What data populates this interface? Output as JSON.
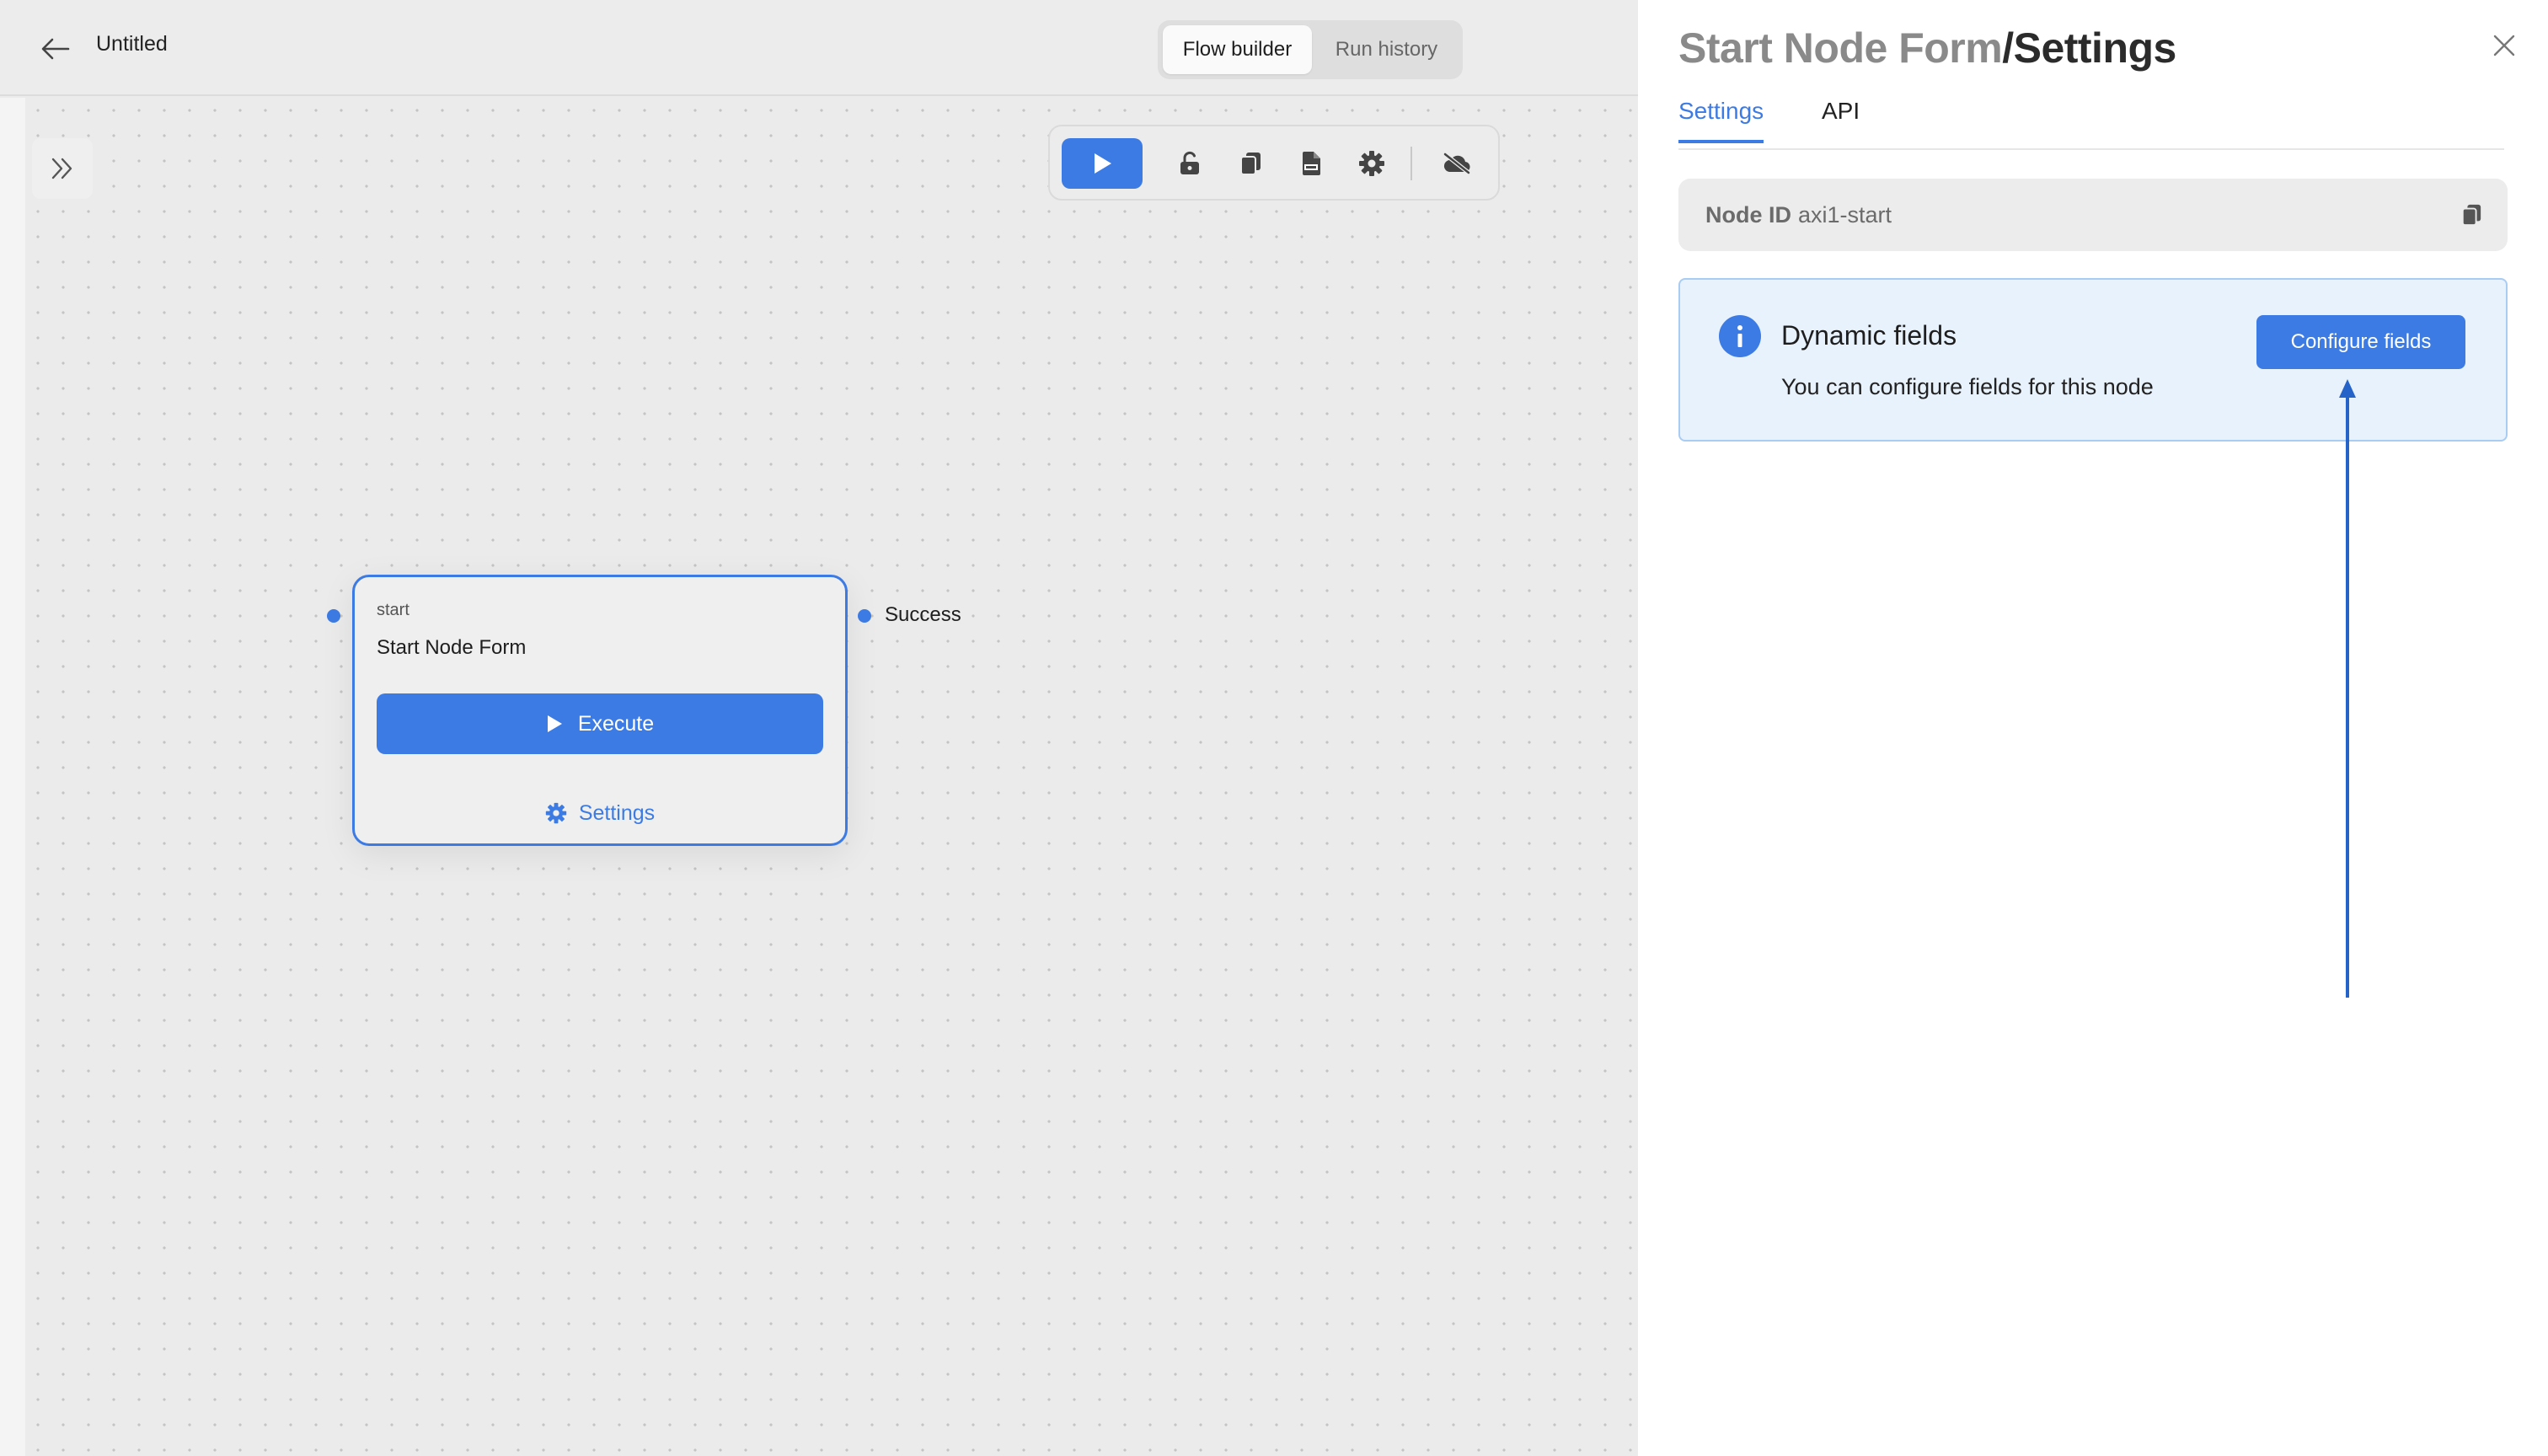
{
  "header": {
    "title": "Untitled",
    "modes": [
      {
        "label": "Flow builder",
        "active": true
      },
      {
        "label": "Run history",
        "active": false
      }
    ]
  },
  "toolbar": {
    "icons": [
      "play-icon",
      "unlock-icon",
      "copy-icon",
      "log-file-icon",
      "gear-icon",
      "cloud-off-icon"
    ]
  },
  "node": {
    "type": "start",
    "name": "Start Node Form",
    "execute_label": "Execute",
    "settings_label": "Settings",
    "output_label": "Success"
  },
  "panel": {
    "title_node": "Start Node Form",
    "title_section": "/Settings",
    "tabs": [
      {
        "label": "Settings",
        "active": true
      },
      {
        "label": "API",
        "active": false
      }
    ],
    "node_id_label": "Node ID",
    "node_id_value": "axi1-start",
    "dynamic": {
      "title": "Dynamic fields",
      "description": "You can configure fields for this node",
      "button_label": "Configure fields"
    }
  },
  "colors": {
    "accent": "#3d7be4",
    "info_bg": "#e8f2fd",
    "info_border": "#a9ccf3",
    "canvas_bg": "#ebebeb"
  }
}
